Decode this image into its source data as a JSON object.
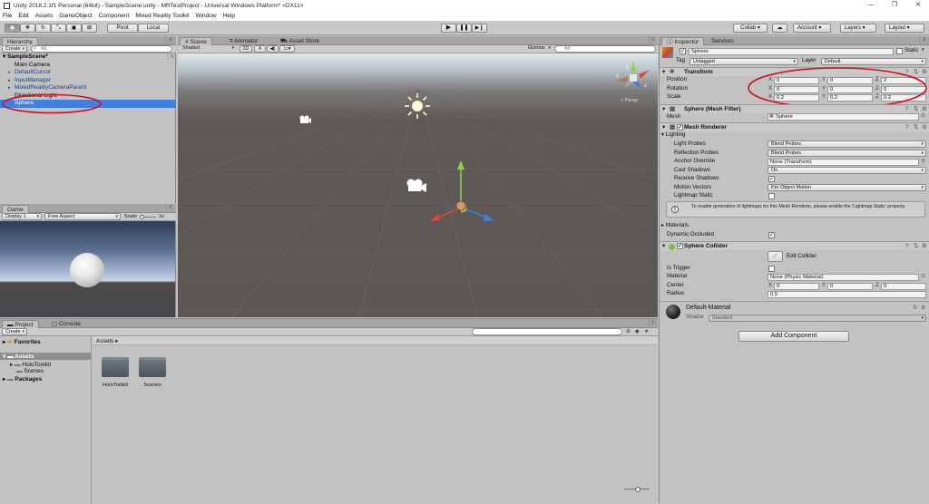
{
  "window": {
    "title": "Unity 2018.2.1f1 Personal (64bit) - SampleScene.unity - MRTestProject - Universal Windows Platform* <DX11>",
    "minimize": "—",
    "maximize": "❐",
    "close": "✕"
  },
  "menu": [
    "File",
    "Edit",
    "Assets",
    "GameObject",
    "Component",
    "Mixed Reality Toolkit",
    "Window",
    "Help"
  ],
  "toolbar": {
    "pivot": "Pivot",
    "local": "Local",
    "collab": "Collab ▾",
    "account": "Account",
    "layers": "Layers",
    "layout": "Layout"
  },
  "hierarchy": {
    "tab": "Hierarchy",
    "create": "Create",
    "search_placeholder": "All",
    "scene": "SampleScene*",
    "items": [
      {
        "label": "Main Camera",
        "style": ""
      },
      {
        "label": "DefaultCursor",
        "style": "blue"
      },
      {
        "label": "InputManager",
        "style": "blue"
      },
      {
        "label": "MixedRealityCameraParent",
        "style": "blue"
      },
      {
        "label": "Directional Light",
        "style": ""
      },
      {
        "label": "Sphere",
        "style": "sel"
      }
    ]
  },
  "scene": {
    "tabs": [
      "Scene",
      "Animator",
      "Asset Store"
    ],
    "shading": "Shaded",
    "mode2d": "2D",
    "gizmos": "Gizmos",
    "search_placeholder": "All",
    "persp": "< Persp",
    "gizmo_labels": {
      "y": "y",
      "x": "x",
      "z": "z"
    }
  },
  "game": {
    "tabs": [
      "Game"
    ],
    "display": "Display 1",
    "aspect": "Free Aspect",
    "scale_label": "Scale",
    "scale_value": "1x"
  },
  "project": {
    "tabs": [
      "Project",
      "Console"
    ],
    "create": "Create",
    "favorites": "Favorites",
    "assets": "Assets",
    "holotoolkit": "HoloToolkit",
    "scenes": "Scenes",
    "packages": "Packages",
    "breadcrumb": "Assets ▸",
    "folders": [
      "HoloToolkit",
      "Scenes"
    ]
  },
  "inspector": {
    "tabs": [
      "Inspector",
      "Services"
    ],
    "object_name": "Sphere",
    "static_label": "Static",
    "tag_label": "Tag",
    "tag_value": "Untagged",
    "layer_label": "Layer",
    "layer_value": "Default",
    "transform": {
      "title": "Transform",
      "position_label": "Position",
      "rotation_label": "Rotation",
      "scale_label": "Scale",
      "position": [
        "0",
        "0",
        "2"
      ],
      "rotation": [
        "0",
        "0",
        "0"
      ],
      "scale": [
        "0.2",
        "0.2",
        "0.2"
      ]
    },
    "mesh_filter": {
      "title": "Sphere (Mesh Filter)",
      "mesh_label": "Mesh",
      "mesh_value": "Sphere"
    },
    "mesh_renderer": {
      "title": "Mesh Renderer",
      "lighting": "Lighting",
      "light_probes_label": "Light Probes",
      "light_probes": "Blend Probes",
      "reflection_probes_label": "Reflection Probes",
      "reflection_probes": "Blend Probes",
      "anchor_override_label": "Anchor Override",
      "anchor_override": "None (Transform)",
      "cast_shadows_label": "Cast Shadows",
      "cast_shadows": "On",
      "receive_shadows_label": "Receive Shadows",
      "motion_vectors_label": "Motion Vectors",
      "motion_vectors": "Per Object Motion",
      "lightmap_static_label": "Lightmap Static",
      "info": "To enable generation of lightmaps for this Mesh Renderer, please enable the 'Lightmap Static' property.",
      "materials": "Materials",
      "dynamic_occluded_label": "Dynamic Occluded"
    },
    "sphere_collider": {
      "title": "Sphere Collider",
      "edit_collider": "Edit Collider",
      "is_trigger_label": "Is Trigger",
      "material_label": "Material",
      "material_value": "None (Physic Material)",
      "center_label": "Center",
      "center": [
        "0",
        "0",
        "0"
      ],
      "radius_label": "Radius",
      "radius": "0.5"
    },
    "material": {
      "name": "Default-Material",
      "shader_label": "Shader",
      "shader_value": "Standard"
    },
    "add_component": "Add Component"
  },
  "colors": {
    "selection": "#3d80df",
    "annotation": "#d4111e",
    "scene_bg": "#5c5754"
  }
}
